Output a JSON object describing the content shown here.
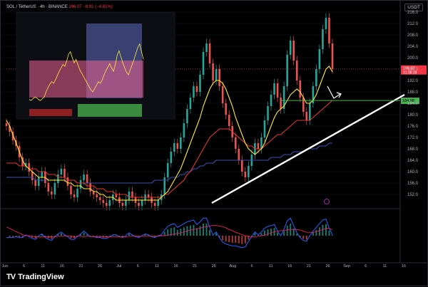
{
  "header": {
    "symbol": "SOL / TetherUS · 4h · BINANCE",
    "last": "196.07",
    "change": "−8.91 (−4.81%)"
  },
  "currency_label": "USDT",
  "branding": {
    "logo_mark": "TV",
    "name": "TradingView"
  },
  "colors": {
    "background": "#000000",
    "up_candle": "#26a69a",
    "down_candle": "#ef5350",
    "ma_fast": "#ffeb3b",
    "ma_mid": "#e53935",
    "ma_slow": "#3f51b5",
    "trendline": "#ffffff",
    "support": "#4caf50",
    "current_price_tag": "#f23645"
  },
  "chart_data": {
    "type": "candlestick",
    "ylim": [
      148,
      216
    ],
    "y_ticks": [
      216.0,
      212.0,
      208.0,
      204.0,
      200.0,
      196.0,
      192.0,
      188.0,
      184.0,
      180.0,
      176.0,
      172.0,
      168.0,
      164.0,
      160.0,
      156.0,
      152.0
    ],
    "x_ticks": [
      "Jun",
      "6",
      "11",
      "16",
      "21",
      "26",
      "Jul",
      "6",
      "11",
      "16",
      "21",
      "26",
      "Aug",
      "6",
      "11",
      "16",
      "21",
      "26",
      "Sep",
      "6",
      "11",
      "16"
    ],
    "price_tags": {
      "current": "196.07",
      "countdown": "01:08:39",
      "support": "184.98"
    },
    "close": [
      176,
      174,
      171,
      169,
      165,
      162,
      163,
      160,
      157,
      155,
      158,
      160,
      156,
      153,
      152,
      156,
      159,
      161,
      158,
      155,
      152,
      151,
      154,
      157,
      159,
      156,
      153,
      152,
      151,
      150,
      149,
      148,
      150,
      152,
      151,
      149,
      148,
      150,
      153,
      151,
      149,
      148,
      150,
      152,
      151,
      149,
      148,
      150,
      152,
      158,
      163,
      167,
      170,
      168,
      172,
      177,
      182,
      186,
      190,
      188,
      194,
      202,
      205,
      198,
      192,
      196,
      190,
      184,
      180,
      176,
      172,
      168,
      164,
      160,
      158,
      162,
      166,
      170,
      168,
      172,
      178,
      183,
      187,
      191,
      186,
      182,
      190,
      201,
      206,
      199,
      192,
      186,
      181,
      178,
      184,
      190,
      196,
      203,
      210,
      214,
      205,
      196
    ],
    "ma_fast": [
      178,
      176,
      173,
      170,
      167,
      164,
      162,
      161,
      160,
      159,
      158,
      158,
      158,
      157,
      157,
      157,
      157,
      157,
      157,
      156,
      156,
      155,
      155,
      155,
      154,
      154,
      154,
      153,
      153,
      152,
      152,
      151,
      151,
      151,
      150,
      150,
      150,
      150,
      150,
      150,
      150,
      150,
      150,
      150,
      150,
      150,
      150,
      150,
      151,
      152,
      153,
      155,
      157,
      159,
      161,
      164,
      167,
      170,
      173,
      176,
      179,
      183,
      186,
      189,
      191,
      192,
      192,
      191,
      189,
      186,
      183,
      179,
      176,
      173,
      170,
      168,
      167,
      166,
      167,
      168,
      170,
      173,
      176,
      179,
      181,
      182,
      183,
      185,
      187,
      188,
      189,
      188,
      186,
      184,
      184,
      185,
      187,
      190,
      193,
      196,
      197,
      195
    ],
    "ma_mid": [
      163,
      163,
      163,
      163,
      162,
      162,
      162,
      161,
      161,
      161,
      160,
      160,
      160,
      159,
      159,
      159,
      158,
      158,
      158,
      157,
      157,
      157,
      156,
      156,
      156,
      155,
      155,
      155,
      154,
      154,
      154,
      153,
      153,
      153,
      152,
      152,
      152,
      152,
      151,
      151,
      151,
      151,
      151,
      151,
      151,
      151,
      151,
      151,
      151,
      152,
      152,
      153,
      154,
      155,
      156,
      157,
      159,
      160,
      162,
      164,
      166,
      168,
      170,
      172,
      173,
      174,
      175,
      175,
      175,
      175,
      174,
      173,
      172,
      171,
      170,
      169,
      169,
      168,
      168,
      168,
      169,
      170,
      171,
      172,
      173,
      173,
      174,
      175,
      176,
      177,
      178,
      178,
      178,
      178,
      178,
      179,
      180,
      181,
      182,
      183,
      184,
      185
    ],
    "ma_slow": [
      158,
      158,
      158,
      158,
      158,
      158,
      158,
      158,
      158,
      157,
      157,
      157,
      157,
      157,
      157,
      157,
      157,
      157,
      157,
      157,
      157,
      157,
      156,
      156,
      156,
      156,
      156,
      156,
      156,
      156,
      156,
      156,
      156,
      156,
      156,
      156,
      156,
      156,
      156,
      156,
      156,
      156,
      156,
      156,
      156,
      156,
      157,
      157,
      157,
      157,
      157,
      158,
      158,
      158,
      159,
      159,
      160,
      160,
      161,
      161,
      162,
      162,
      163,
      163,
      163,
      164,
      164,
      164,
      164,
      164,
      164,
      164,
      164,
      164,
      164,
      164,
      164,
      164,
      164,
      164,
      164,
      164,
      165,
      165,
      165,
      165,
      166,
      166,
      166,
      167,
      167,
      167,
      167,
      168,
      168,
      168,
      168,
      169,
      169,
      169,
      170,
      170
    ]
  }
}
